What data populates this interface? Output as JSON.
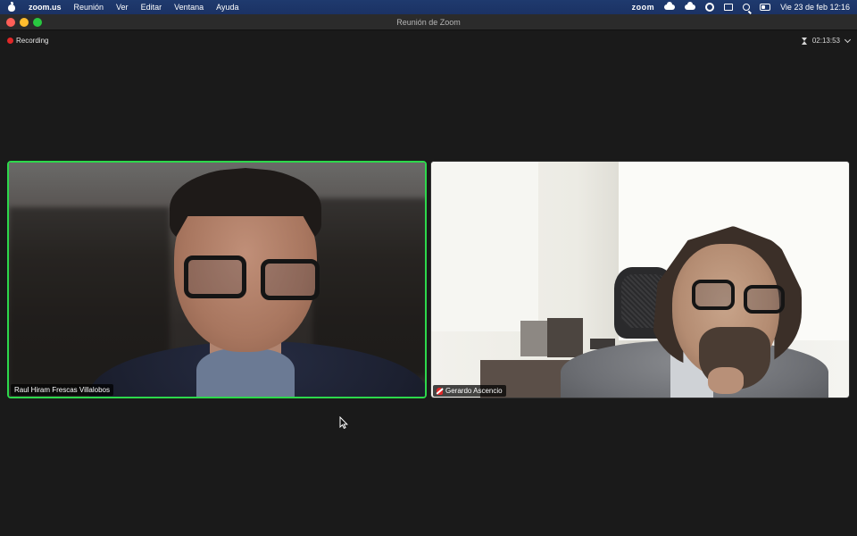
{
  "menubar": {
    "app_name": "zoom.us",
    "menus": [
      "Reunión",
      "Ver",
      "Editar",
      "Ventana",
      "Ayuda"
    ],
    "zoom_status": "zoom",
    "datetime": "Vie 23 de feb  12:16"
  },
  "window": {
    "title": "Reunión de Zoom"
  },
  "meeting": {
    "recording_label": "Recording",
    "timer": "02:13:53",
    "participants": [
      {
        "name": "Raul Hiram Frescas Villalobos",
        "active_speaker": true,
        "muted": false
      },
      {
        "name": "Gerardo Ascencio",
        "active_speaker": false,
        "muted": true
      }
    ]
  },
  "colors": {
    "active_speaker_border": "#2dd84b",
    "recording_dot": "#e02828",
    "background": "#1a1a1a"
  }
}
